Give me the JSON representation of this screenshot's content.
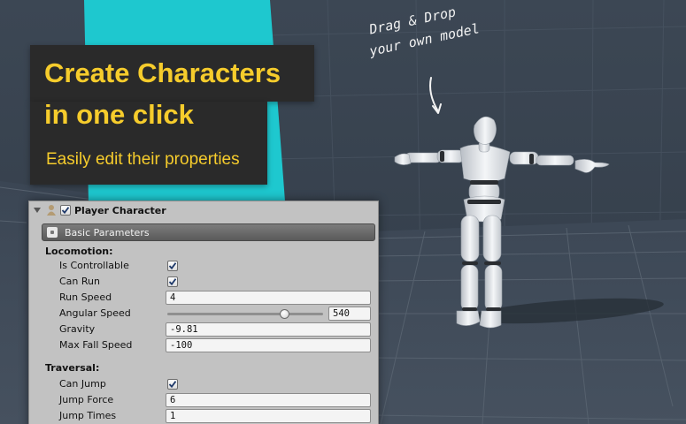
{
  "banner": {
    "headline_line1": "Create Characters",
    "headline_line2": "in one click",
    "subheadline": "Easily edit their properties",
    "accent_color": "#f6cc2c",
    "background_color": "#2a2a2a"
  },
  "note": {
    "line1": "Drag & Drop",
    "line2": "your own model"
  },
  "inspector": {
    "component_title": "Player Character",
    "component_enabled": true,
    "section_title": "Basic Parameters",
    "locomotion": {
      "group_label": "Locomotion:",
      "is_controllable": {
        "label": "Is Controllable",
        "checked": true
      },
      "can_run": {
        "label": "Can Run",
        "checked": true
      },
      "run_speed": {
        "label": "Run Speed",
        "value": "4"
      },
      "angular_speed": {
        "label": "Angular Speed",
        "value": "540",
        "slider_fraction": 0.75
      },
      "gravity": {
        "label": "Gravity",
        "value": "-9.81"
      },
      "max_fall_speed": {
        "label": "Max Fall Speed",
        "value": "-100"
      }
    },
    "traversal": {
      "group_label": "Traversal:",
      "can_jump": {
        "label": "Can Jump",
        "checked": true
      },
      "jump_force": {
        "label": "Jump Force",
        "value": "6"
      },
      "jump_times": {
        "label": "Jump Times",
        "value": "1"
      }
    }
  },
  "colors": {
    "scene_background": "#35404d",
    "cyan_panel": "#1ec8cf",
    "mannequin": "#e9ecef",
    "mannequin_joint": "#2a2d31"
  }
}
